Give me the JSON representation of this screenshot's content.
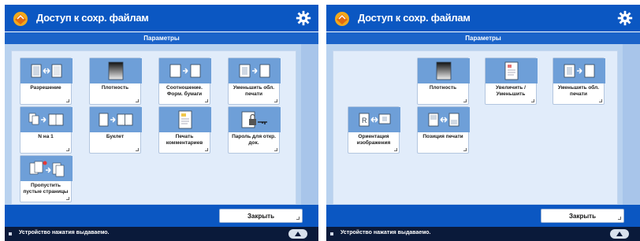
{
  "left": {
    "title": "Доступ к сохр. файлам",
    "subtitle": "Параметры",
    "tiles": [
      {
        "label": "Разрешение",
        "icon": "resolution-icon"
      },
      {
        "label": "Плотность",
        "icon": "density-icon"
      },
      {
        "label": "Соотношение. Форм. бумаги",
        "icon": "paper-size-icon"
      },
      {
        "label": "Уменьшить обл. печати",
        "icon": "reduce-area-icon"
      },
      {
        "label": "N на 1",
        "icon": "n-on-1-icon"
      },
      {
        "label": "Буклет",
        "icon": "booklet-icon"
      },
      {
        "label": "Печать комментариев",
        "icon": "print-comments-icon"
      },
      {
        "label": "Пароль для откр. док.",
        "icon": "password-icon"
      },
      {
        "label": "Пропустить пустые страницы",
        "icon": "skip-blank-pages-icon"
      }
    ],
    "close_label": "Закрыть",
    "status": "Устройство нажатия выдаваемо."
  },
  "right": {
    "title": "Доступ к сохр. файлам",
    "subtitle": "Параметры",
    "tiles": [
      {
        "label": "Плотность",
        "icon": "density-icon"
      },
      {
        "label": "Увеличить / Уменьшить",
        "icon": "zoom-icon"
      },
      {
        "label": "Уменьшить обл. печати",
        "icon": "reduce-area-icon"
      },
      {
        "label": "Ориентация изображения",
        "icon": "image-orientation-icon"
      },
      {
        "label": "Позиция печати",
        "icon": "print-position-icon"
      }
    ],
    "close_label": "Закрыть",
    "status": "Устройство нажатия выдаваемо."
  },
  "colors": {
    "titlebar": "#0b57c2",
    "panel": "#b9d2ef",
    "tile_icon": "#6e9fd8",
    "statusbar": "#0a1a3a"
  }
}
